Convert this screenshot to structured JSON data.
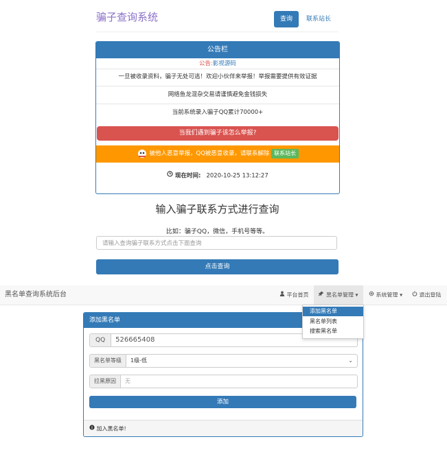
{
  "site": {
    "title": "骗子查询系统",
    "nav": {
      "query": "查询",
      "contact": "联系站长"
    }
  },
  "notice": {
    "header": "公告栏",
    "sub_label": "公告:",
    "sub_link": "影视源码",
    "lines": [
      "一旦被收录资料，骗子无处可逃！欢迎小伙伴来举报！举报需要提供有效证据",
      "网络鱼龙混杂交易请谨慎避免金钱损失",
      "当前系统录入骗子QQ累计70000+"
    ],
    "report_button": "当我们遇到骗子该怎么举报?",
    "warning_text": "被他人恶意举报，QQ被恶意收录，请联系解除",
    "warning_button": "联系站长",
    "time_label": "现在时间:",
    "time_value": "2020-10-25 13:12:27"
  },
  "query": {
    "title": "输入骗子联系方式进行查询",
    "example": "比如：骗子QQ，微信，手机号等等。",
    "placeholder": "请输入查询骗子联系方式点击下面查询",
    "button": "点击查询"
  },
  "admin": {
    "brand": "黑名单查询系统后台",
    "nav": {
      "home": "平台首页",
      "blacklist": "黑名单管理",
      "settings": "系统管理",
      "logout": "退出登陆"
    },
    "dropdown": [
      "添加黑名单",
      "黑名单列表",
      "搜索黑名单"
    ],
    "panel": {
      "header": "添加黑名单",
      "qq_label": "QQ",
      "qq_value": "526665408",
      "level_label": "黑名单等级",
      "level_value": "1级-低",
      "reason_label": "拉黑原因",
      "reason_value": "无",
      "submit": "添加",
      "footer": "加入黑名单!"
    }
  },
  "colors": {
    "primary": "#337ab7",
    "danger": "#d9534f",
    "warning": "#ff9800",
    "success": "#5cb85c",
    "title_purple": "#8a6fc8"
  }
}
